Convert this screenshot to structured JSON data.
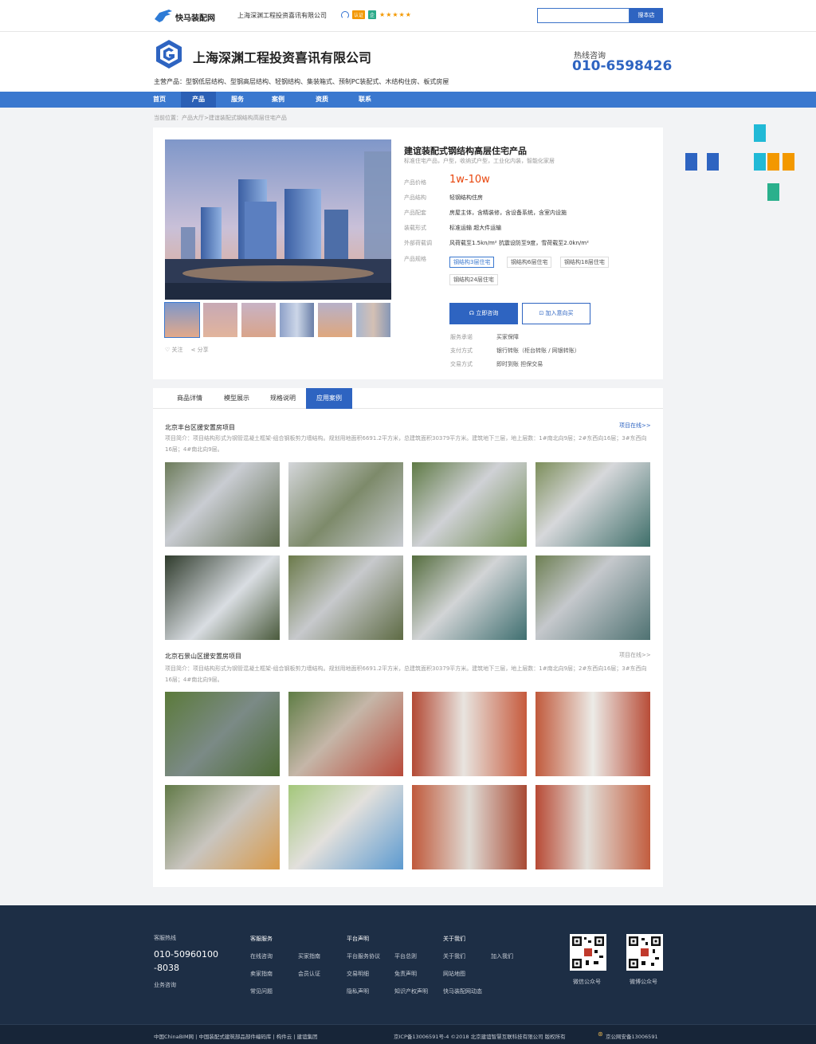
{
  "topbar": {
    "site_name": "快马装配网",
    "company": "上海深渊工程投资喜讯有限公司",
    "badge_v": "认证",
    "badge_g": "企",
    "stars": "★★★★★",
    "search_placeholder": "",
    "search_button": "搜本店"
  },
  "header": {
    "company_name": "上海深渊工程投资喜讯有限公司",
    "products_line": "主营产品：型钢低层结构、型钢高层结构、轻钢结构、集装箱式、预制PC装配式、木结构住房、板式房屋",
    "hotline_label": "热线咨询",
    "hotline_number": "010-6598426"
  },
  "nav": [
    "首页",
    "产品",
    "服务",
    "案例",
    "资质",
    "联系"
  ],
  "breadcrumb": "当前位置：产品大厅>建谊装配式钢结构高层住宅产品",
  "product": {
    "title": "建谊装配式钢结构高层住宅产品",
    "subtitle": "标准住宅产品，户型，收纳式户型，工业化内装，智能化家居",
    "rows": [
      {
        "label": "产品价格",
        "value": "1w-10w"
      },
      {
        "label": "产品结构",
        "value": "轻钢结构住房"
      },
      {
        "label": "产品配套",
        "value": "房屋主体，含精装修，含设备系统，含室内设施"
      },
      {
        "label": "装载形式",
        "value": "标准运输  超大件运输"
      },
      {
        "label": "外部荷载调",
        "value": "风荷载至1.5kn/m²  抗震设防至9度，雪荷载至2.0kn/m²"
      },
      {
        "label": "产品规格",
        "value": ""
      }
    ],
    "specs": [
      "钢结构3层住宅",
      "钢结构6层住宅",
      "钢结构18层住宅",
      "钢结构24层住宅"
    ],
    "consult_button": "立即咨询",
    "cart_button": "加入意向买",
    "services": [
      {
        "label": "服务承诺",
        "value": "买家保障"
      },
      {
        "label": "支付方式",
        "value": "银行转账（柜台转账 / 网银转账）"
      },
      {
        "label": "交易方式",
        "value": "即时到账  担保交易"
      }
    ],
    "follow": "关注",
    "share": "分享"
  },
  "tabs": [
    "商品详情",
    "模型展示",
    "规格说明",
    "应用案例"
  ],
  "cases": [
    {
      "title": "北京丰台区援安置房项目",
      "link": "项目在线>>",
      "desc": "项目简介：项目结构形式为钢管混凝土框架-组合钢板剪力墙结构。规划用地面积6691.2平方米，总建筑面积30379平方米。建筑地下三层，地上层数：1#南北向9层；2#东西向16层；3#东西向16层；4#南北向9层。"
    },
    {
      "title": "北京石景山区援安置房项目",
      "link": "项目在线>>",
      "desc": "项目简介：项目结构形式为钢管混凝土框架-组合钢板剪力墙结构。规划用地面积6691.2平方米，总建筑面积30379平方米。建筑地下三层，地上层数：1#南北向9层；2#东西向16层；3#东西向16层；4#南北向9层。"
    }
  ],
  "footer": {
    "service_hotline_label": "客服热线",
    "service_hotline_1": "010-50960100",
    "service_hotline_2": "-8038",
    "service_consult": "业务咨询",
    "col_service_title": "客服服务",
    "col_service": [
      "在线咨询",
      "买家指南",
      "卖家指南",
      "会员认证",
      "常见问题"
    ],
    "col_platform_title": "平台声明",
    "col_platform": [
      "平台服务协议",
      "平台总则",
      "交易明细",
      "免责声明",
      "隐私声明",
      "知识产权声明"
    ],
    "col_about_title": "关于我们",
    "col_about": [
      "关于我们",
      "加入我们",
      "网站地图",
      "快马装配网动态"
    ],
    "qr_wechat": "微信公众号",
    "qr_weibo": "微博公众号",
    "bottom_left": "中国ChinaBIM网 | 中国装配式建筑部品部件编码库 | 构件云 | 建谊集团",
    "bottom_icp": "京ICP备13006591号-4  ©2018 北京建谊智慧互联科技有限公司 版权所有",
    "bottom_police": "京公网安备13006591"
  },
  "colors": {
    "primary": "#2e64c1",
    "nav": "#3a78cf",
    "price": "#e8450c",
    "footer": "#1d2e45"
  }
}
